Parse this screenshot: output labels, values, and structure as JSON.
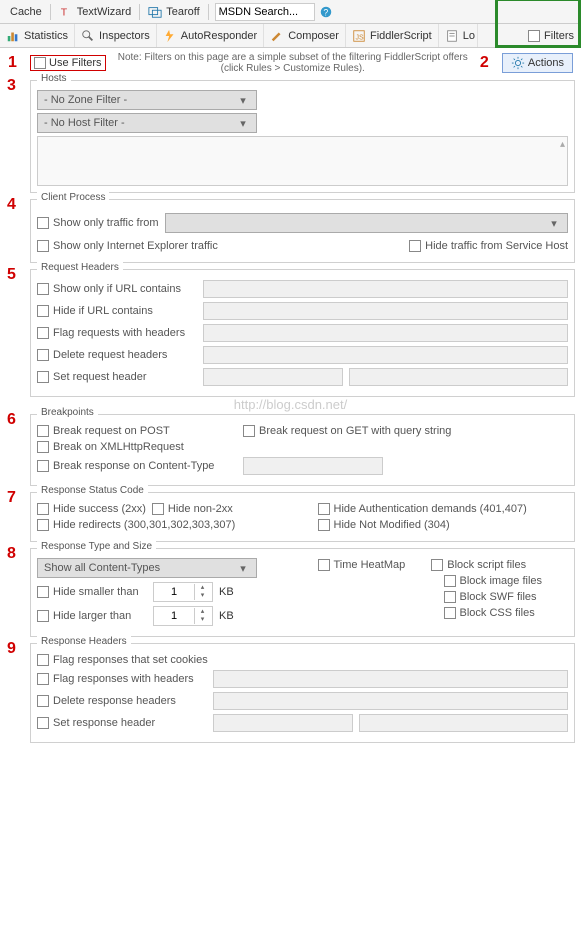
{
  "toolbar1": {
    "cache": "Cache",
    "textwizard": "TextWizard",
    "tearoff": "Tearoff",
    "search": "MSDN Search..."
  },
  "tabs": {
    "statistics": "Statistics",
    "inspectors": "Inspectors",
    "autoresponder": "AutoResponder",
    "composer": "Composer",
    "fiddlerscript": "FiddlerScript",
    "log_partial": "Lo",
    "filters": "Filters"
  },
  "header": {
    "use_filters": "Use Filters",
    "note": "Note: Filters on this page are a simple subset of the filtering FiddlerScript offers (click Rules > Customize Rules).",
    "actions": "Actions"
  },
  "nums": {
    "n1": "1",
    "n2": "2",
    "n3": "3",
    "n4": "4",
    "n5": "5",
    "n6": "6",
    "n7": "7",
    "n8": "8",
    "n9": "9"
  },
  "hosts": {
    "title": "Hosts",
    "zone": "- No Zone Filter -",
    "host": "- No Host Filter -"
  },
  "client_process": {
    "title": "Client Process",
    "show_from": "Show only traffic from",
    "ie": "Show only Internet Explorer traffic",
    "svc": "Hide traffic from Service Host"
  },
  "request_headers": {
    "title": "Request Headers",
    "url_contains": "Show only if URL contains",
    "hide_url": "Hide if URL contains",
    "flag_hdr": "Flag requests with headers",
    "del_hdr": "Delete request headers",
    "set_hdr": "Set request header"
  },
  "breakpoints": {
    "title": "Breakpoints",
    "post": "Break request on POST",
    "get_qs": "Break request on GET with query string",
    "xhr": "Break on XMLHttpRequest",
    "ct": "Break response on Content-Type"
  },
  "status": {
    "title": "Response Status Code",
    "s2xx": "Hide success (2xx)",
    "non2xx": "Hide non-2xx",
    "auth": "Hide Authentication demands (401,407)",
    "redir": "Hide redirects (300,301,302,303,307)",
    "notmod": "Hide Not Modified (304)"
  },
  "typesize": {
    "title": "Response Type and Size",
    "showall": "Show all Content-Types",
    "heatmap": "Time HeatMap",
    "block_script": "Block script files",
    "smaller": "Hide smaller than",
    "block_img": "Block image files",
    "larger": "Hide larger than",
    "block_swf": "Block SWF files",
    "block_css": "Block CSS files",
    "kb": "KB",
    "val1": "1",
    "val2": "1"
  },
  "response_headers": {
    "title": "Response Headers",
    "cookies": "Flag responses that set cookies",
    "flag": "Flag responses with headers",
    "del": "Delete response headers",
    "set": "Set response header"
  },
  "watermark": "http://blog.csdn.net/"
}
